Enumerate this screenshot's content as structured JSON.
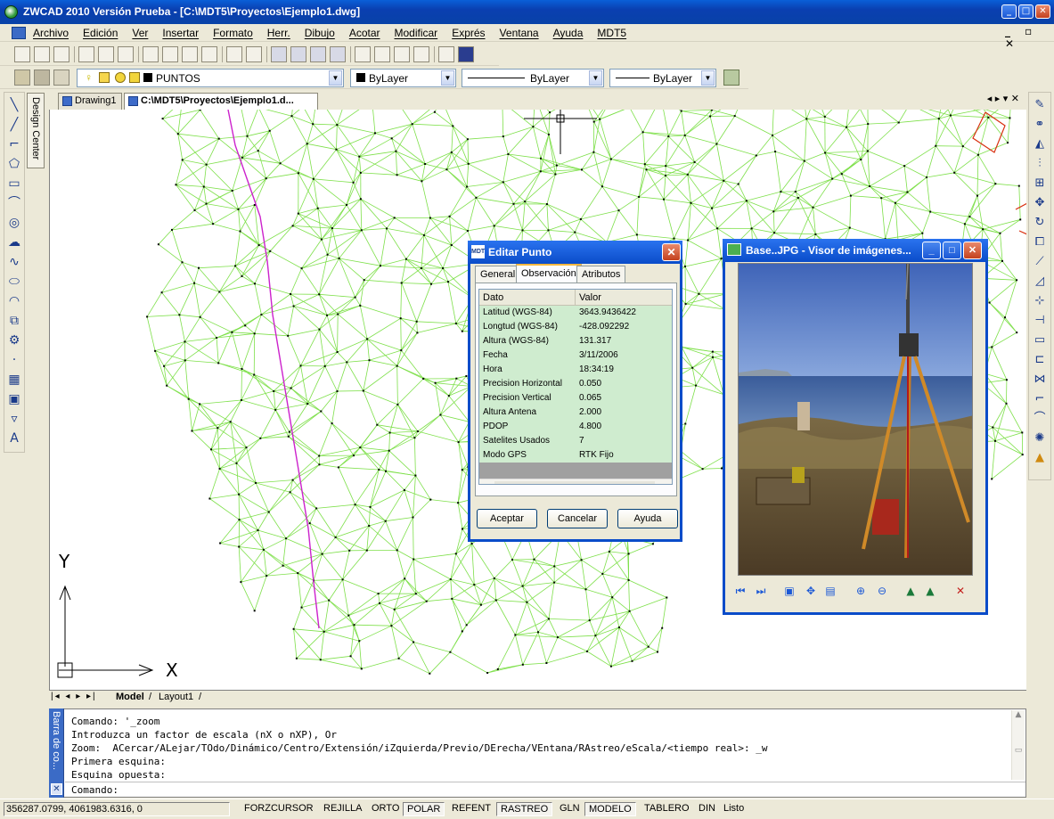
{
  "window": {
    "title": "ZWCAD 2010 Versión Prueba - [C:\\MDT5\\Proyectos\\Ejemplo1.dwg]",
    "min": "_",
    "max": "□",
    "close": "✕"
  },
  "menubar": {
    "items": [
      "Archivo",
      "Edición",
      "Ver",
      "Insertar",
      "Formato",
      "Herr.",
      "Dibujo",
      "Acotar",
      "Modificar",
      "Exprés",
      "Ventana",
      "Ayuda",
      "MDT5"
    ]
  },
  "properties_toolbar": {
    "layer": "PUNTOS",
    "color": "ByLayer",
    "linetype": "ByLayer",
    "lineweight": "ByLayer"
  },
  "design_center": {
    "label": "Design Center"
  },
  "doc_tabs": [
    {
      "label": "Drawing1"
    },
    {
      "label": "C:\\MDT5\\Proyectos\\Ejemplo1.d..."
    }
  ],
  "ucs": {
    "y": "Y",
    "x": "X"
  },
  "layout_tabs": {
    "model": "Model",
    "layout1": "Layout1"
  },
  "command": {
    "side_label": "Barra de co...",
    "lines": [
      "Comando: '_zoom",
      "Introduzca un factor de escala (nX o nXP), Or",
      "Zoom:  ACercar/ALejar/TOdo/Dinámico/Centro/Extensión/iZquierda/Previo/DErecha/VEntana/RAstreo/eScala/<tiempo real>: _w",
      "Primera esquina:",
      "Esquina opuesta:"
    ],
    "prompt": "Comando:"
  },
  "statusbar": {
    "coords": "356287.0799, 4061983.6316, 0",
    "buttons": [
      {
        "label": "FORZCURSOR",
        "on": false
      },
      {
        "label": "REJILLA",
        "on": false
      },
      {
        "label": "ORTO",
        "on": false
      },
      {
        "label": "POLAR",
        "on": true
      },
      {
        "label": "REFENT",
        "on": false
      },
      {
        "label": "RASTREO",
        "on": true
      },
      {
        "label": "GLN",
        "on": false
      },
      {
        "label": "MODELO",
        "on": true
      },
      {
        "label": "TABLERO",
        "on": false
      },
      {
        "label": "DIN",
        "on": false
      }
    ],
    "ready": "Listo"
  },
  "dialog": {
    "title": "Editar Punto",
    "icon_text": "MDT",
    "tabs": [
      "General",
      "Observación",
      "Atributos"
    ],
    "active_tab": "Observación",
    "headers": {
      "field": "Dato",
      "value": "Valor"
    },
    "rows": [
      {
        "field": "Latitud (WGS-84)",
        "value": "3643.9436422"
      },
      {
        "field": "Longtud (WGS-84)",
        "value": "-428.092292"
      },
      {
        "field": "Altura (WGS-84)",
        "value": "131.317"
      },
      {
        "field": "Fecha",
        "value": " 3/11/2006"
      },
      {
        "field": "Hora",
        "value": "18:34:19"
      },
      {
        "field": "Precision Horizontal",
        "value": "0.050"
      },
      {
        "field": "Precision Vertical",
        "value": "0.065"
      },
      {
        "field": "Altura Antena",
        "value": "2.000"
      },
      {
        "field": "PDOP",
        "value": "4.800"
      },
      {
        "field": "Satelites Usados",
        "value": "7"
      },
      {
        "field": "Modo GPS",
        "value": "RTK Fijo"
      }
    ],
    "buttons": {
      "ok": "Aceptar",
      "cancel": "Cancelar",
      "help": "Ayuda"
    }
  },
  "viewer": {
    "title": "Base..JPG - Visor de imágenes..."
  },
  "colors": {
    "tin_lines": "#7ee04a",
    "road_line": "#cc22cc",
    "xp_blue": "#0a4cc9"
  }
}
